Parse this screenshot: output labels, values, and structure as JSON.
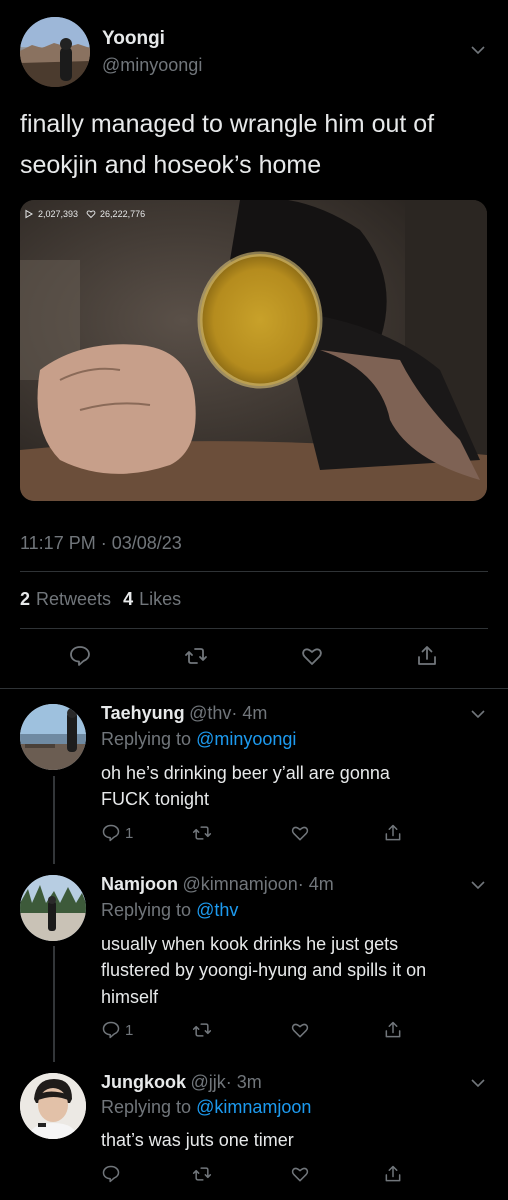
{
  "tweet": {
    "author_name": "Yoongi",
    "author_handle": "@minyoongi",
    "text_line1": "finally managed to wrangle him out of",
    "text_line2": "seokjin and hoseok’s home",
    "video_views": "2,027,393",
    "video_likes": "26,222,776",
    "timestamp": "11:17 PM · 03/08/23",
    "retweets_count": "2",
    "retweets_label": "Retweets",
    "likes_count": "4",
    "likes_label": "Likes"
  },
  "replies": [
    {
      "name": "Taehyung",
      "handle": "@thv",
      "time": "· 4m",
      "replying_label": "Replying to",
      "replying_to": "@minyoongi",
      "lines": [
        "oh he’s drinking beer y’all are gonna",
        "FUCK tonight"
      ],
      "reply_count": "1"
    },
    {
      "name": "Namjoon",
      "handle": "@kimnamjoon",
      "time": "· 4m",
      "replying_label": "Replying to",
      "replying_to": "@thv",
      "lines": [
        "usually when kook drinks he just gets",
        "flustered by yoongi-hyung and spills it on",
        "himself"
      ],
      "reply_count": "1"
    },
    {
      "name": "Jungkook",
      "handle": "@jjk",
      "time": "· 3m",
      "replying_label": "Replying to",
      "replying_to": "@kimnamjoon",
      "lines": [
        "that’s was juts one timer"
      ],
      "reply_count": ""
    }
  ],
  "icons": {
    "reply": "reply-icon",
    "retweet": "retweet-icon",
    "like": "heart-icon",
    "share": "share-icon",
    "more": "chevron-down-icon",
    "play": "play-icon"
  },
  "colors": {
    "background": "#000000",
    "text": "#e7e9ea",
    "muted": "#71767b",
    "link": "#1d9bf0",
    "divider": "#2f3336"
  }
}
